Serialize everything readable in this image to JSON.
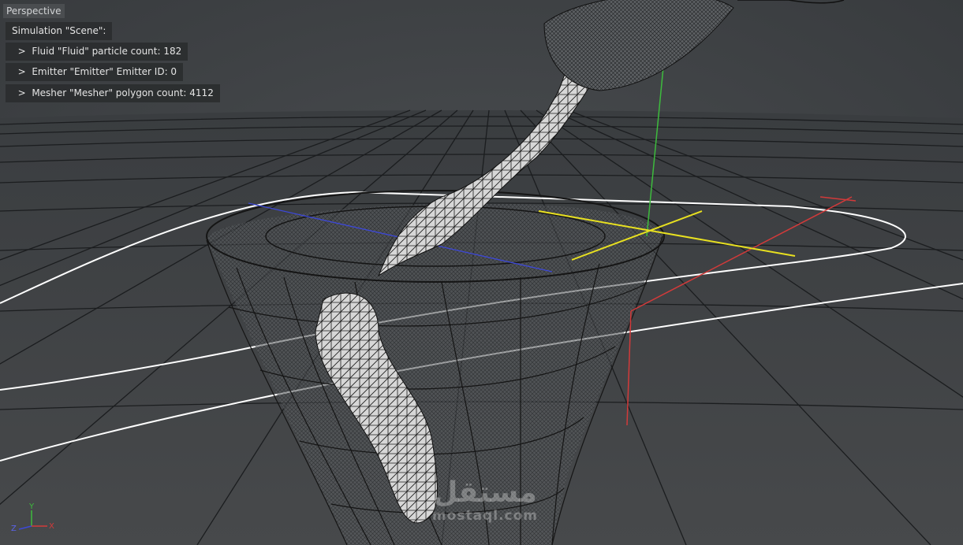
{
  "viewport": {
    "name": "Perspective"
  },
  "hud": {
    "title": "Simulation \"Scene\":",
    "lines": [
      "  >  Fluid \"Fluid\" particle count: 182",
      "  >  Emitter \"Emitter\" Emitter ID: 0",
      "  >  Mesher \"Mesher\" polygon count: 4112"
    ]
  },
  "gizmo": {
    "x": "X",
    "y": "Y",
    "z": "Z"
  },
  "watermark": {
    "arabic": "مستقل",
    "latin": "mostaql.com"
  },
  "colors": {
    "background": "#3c3f42",
    "grid": "#1b1d1f",
    "spline": "#ffffff",
    "axis_x": "#d23a3a",
    "axis_y": "#3dbb3d",
    "axis_z": "#3d48d8",
    "emitter": "#e8e020",
    "mesh_fill": "#d9d9d9"
  }
}
